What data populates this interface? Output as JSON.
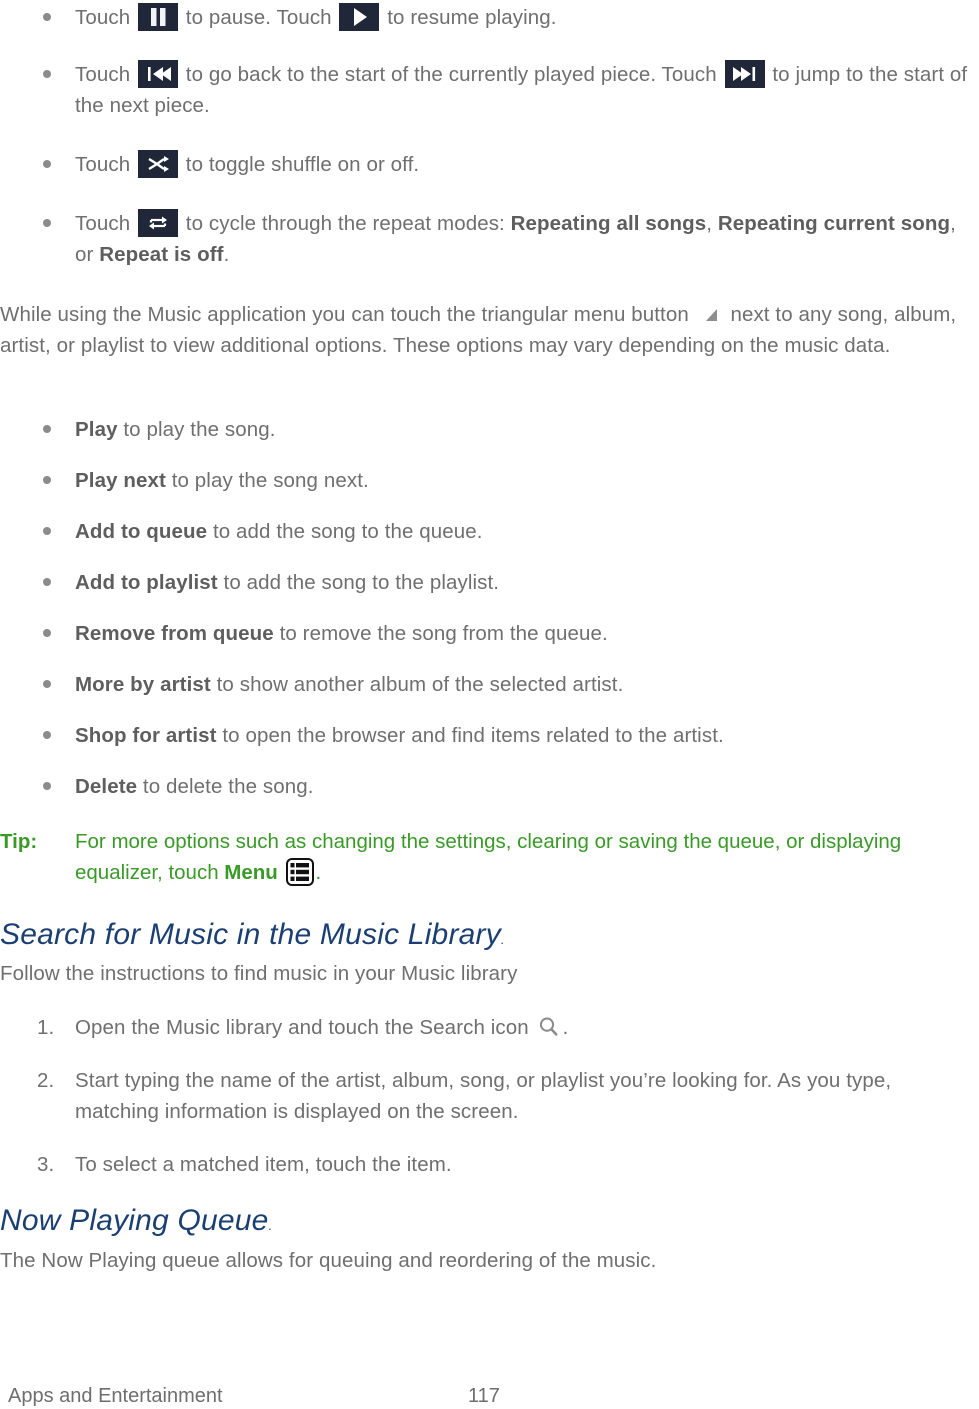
{
  "document": {
    "footer": {
      "section_label": "Apps and Entertainment",
      "page_number": "117"
    }
  },
  "playback_controls": {
    "items": [
      {
        "id": "pause-play",
        "parts": [
          {
            "type": "text",
            "value": "Touch "
          },
          {
            "type": "icon",
            "value": "pause-icon"
          },
          {
            "type": "text",
            "value": " to pause. Touch "
          },
          {
            "type": "icon",
            "value": "play-icon"
          },
          {
            "type": "text",
            "value": " to resume playing."
          }
        ],
        "text_1": "Touch ",
        "text_2": " to pause. Touch ",
        "text_3": " to resume playing."
      },
      {
        "id": "previous-next",
        "text_1": "Touch ",
        "text_2": " to go back to the start of the currently played piece. Touch ",
        "text_3": " to jump to the start of the next piece."
      },
      {
        "id": "shuffle",
        "text_1": "Touch ",
        "text_2": " to toggle shuffle on or off."
      },
      {
        "id": "repeat",
        "text_1": "Touch ",
        "text_2": " to cycle through the repeat modes: ",
        "mode_1": "Repeating all songs",
        "sep_1": ", ",
        "mode_2": "Repeating current song",
        "sep_2": ", or ",
        "mode_3": "Repeat is off",
        "end": "."
      }
    ]
  },
  "menu_intro": {
    "text_1": "While using the Music application you can touch the triangular menu button ",
    "text_2": " next to any song, album, artist, or playlist to view additional options.  These options may vary depending on the music data."
  },
  "context_menu_options": {
    "items": [
      {
        "label": "Play",
        "description": " to play the song."
      },
      {
        "label": "Play next",
        "description": " to play the song next."
      },
      {
        "label": "Add to queue",
        "description": " to add the song to the queue."
      },
      {
        "label": "Add to playlist",
        "description": " to add the song to the playlist."
      },
      {
        "label": "Remove from queue",
        "description": " to remove the song from the queue."
      },
      {
        "label": "More by artist",
        "description": " to show another album of the selected artist."
      },
      {
        "label": "Shop for artist",
        "description": " to open the browser and find items related to the artist."
      },
      {
        "label": "Delete",
        "description": " to delete the song."
      }
    ]
  },
  "tip": {
    "label": "Tip:",
    "text_1": "For more options such as changing the settings, clearing or saving the queue, or displaying equalizer, touch ",
    "menu_word": "Menu",
    "text_2": "."
  },
  "search_section": {
    "heading": "Search for Music in the Music Library",
    "heading_dot": ".",
    "intro": "Follow the instructions to find music in your Music library",
    "steps": [
      {
        "number": "1.",
        "text_1": "Open the Music library and touch the Search icon ",
        "text_2": "."
      },
      {
        "number": "2.",
        "text_1": "Start typing the name of the artist, album, song, or playlist you’re looking for. As you type, matching information is displayed on the screen.",
        "text_2": ""
      },
      {
        "number": "3.",
        "text_1": "To select a matched item, touch the item.",
        "text_2": ""
      }
    ]
  },
  "now_playing_section": {
    "heading": "Now Playing Queue",
    "heading_dot": ".",
    "intro": "The Now Playing queue allows for queuing and reordering of the music."
  },
  "colors": {
    "body_text": "#706f6f",
    "heading_blue": "#1b3f73",
    "tip_green": "#3a9a28",
    "icon_chip_bg": "#1f2739",
    "icon_glyph": "#ffffff",
    "bullet": "#8b8b8b"
  }
}
